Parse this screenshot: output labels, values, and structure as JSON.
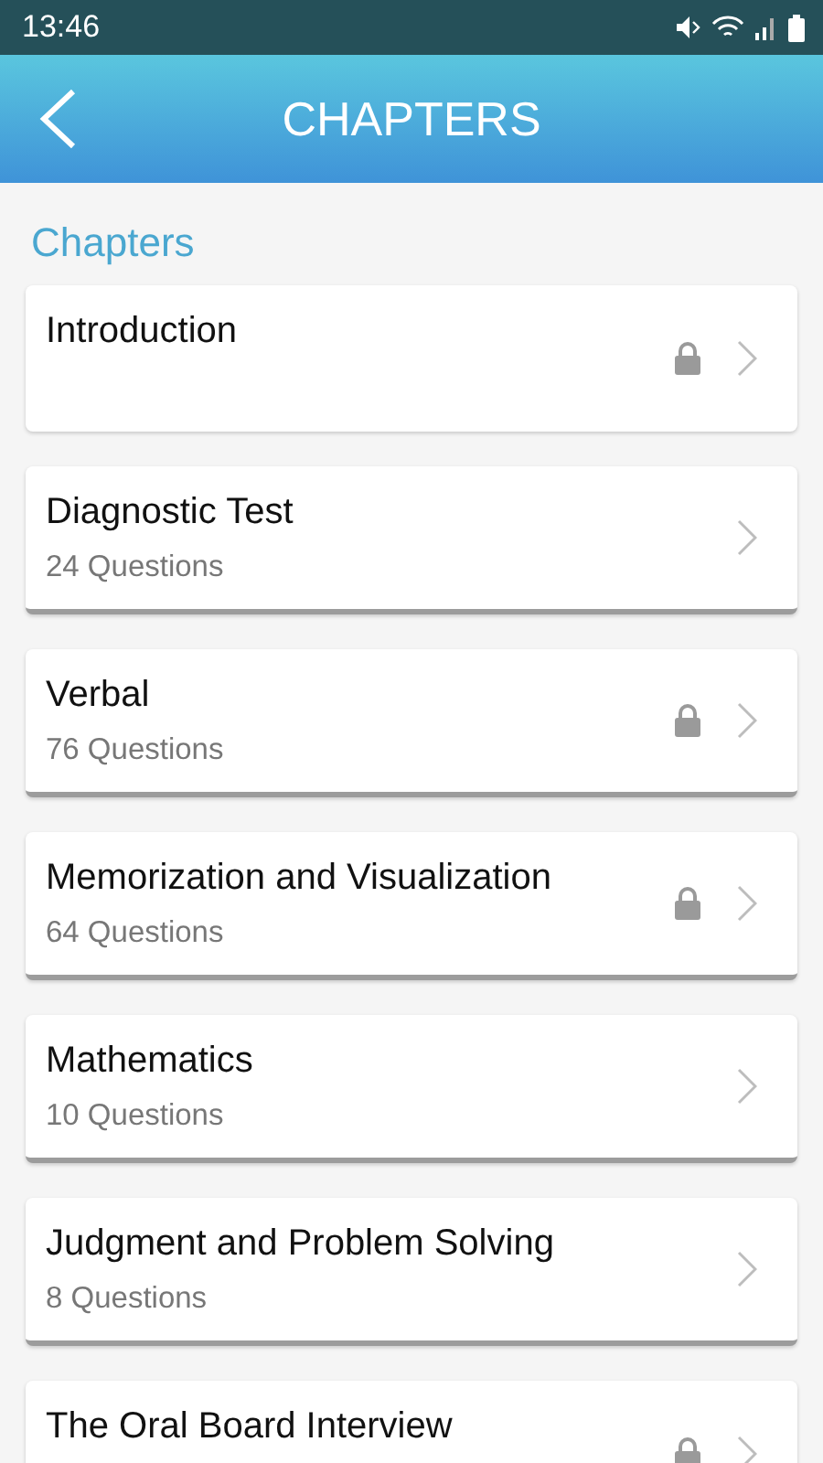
{
  "status_bar": {
    "time": "13:46"
  },
  "header": {
    "title": "CHAPTERS"
  },
  "section_title": "Chapters",
  "chapters": [
    {
      "title": "Introduction",
      "locked": true
    },
    {
      "title": "Diagnostic Test",
      "subtitle": "24 Questions",
      "locked": false
    },
    {
      "title": "Verbal",
      "subtitle": "76 Questions",
      "locked": true
    },
    {
      "title": "Memorization and Visualization",
      "subtitle": "64 Questions",
      "locked": true
    },
    {
      "title": "Mathematics",
      "subtitle": "10 Questions",
      "locked": false
    },
    {
      "title": "Judgment and Problem Solving",
      "subtitle": "8 Questions",
      "locked": false
    },
    {
      "title": "The Oral Board Interview",
      "locked": true
    }
  ]
}
